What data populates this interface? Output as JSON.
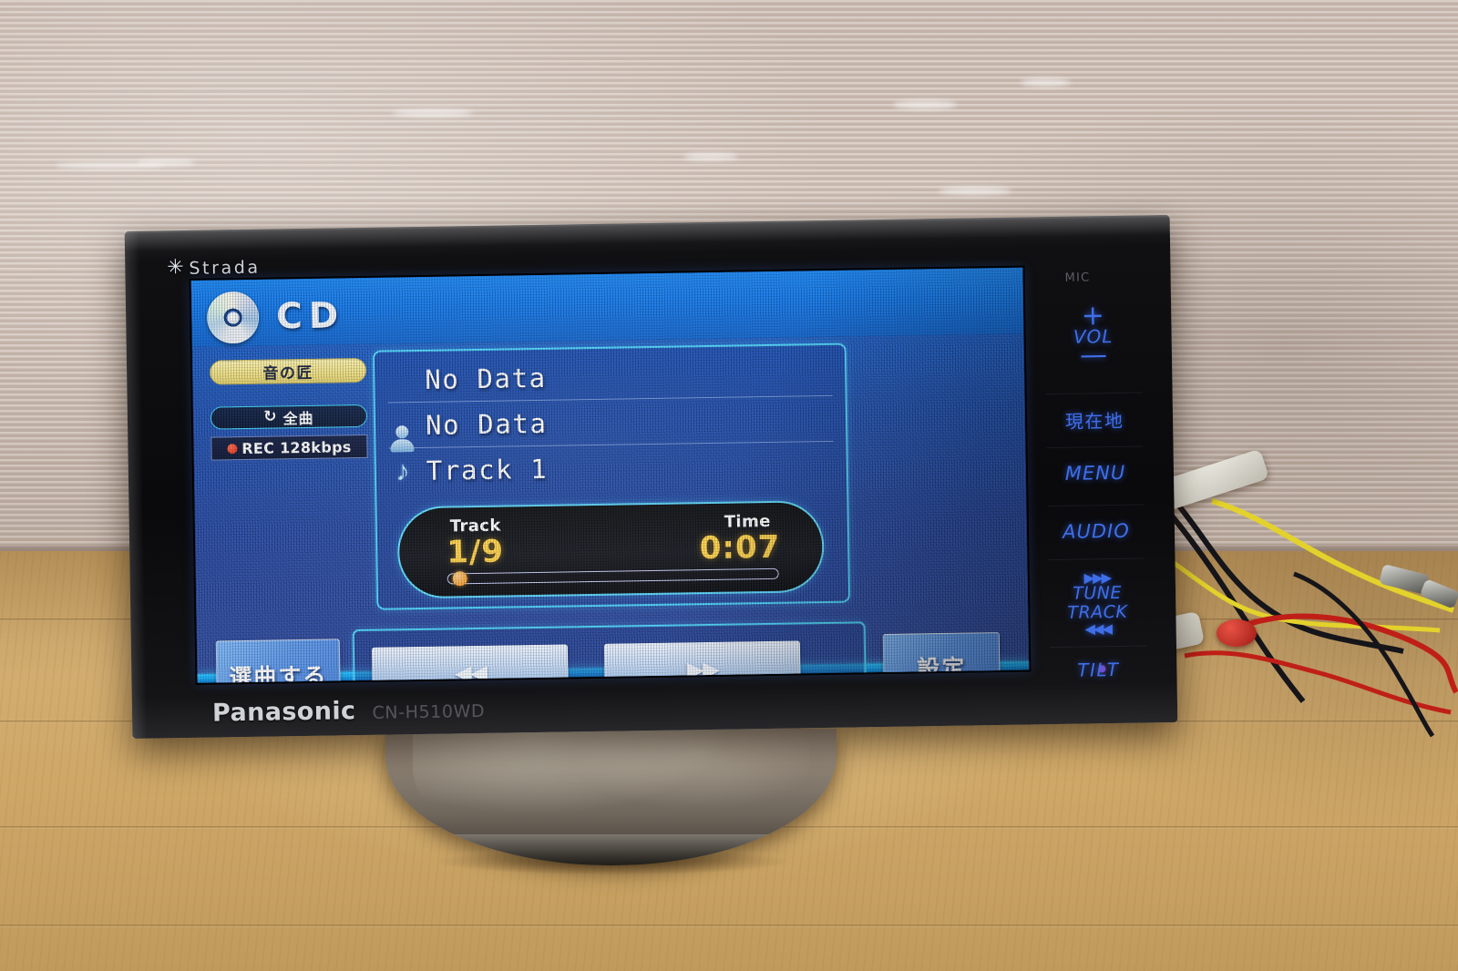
{
  "scene": {
    "description": "Panasonic Strada CN-H510WD car navigation head unit standing on a metal stand on a wooden floor against a striped wall"
  },
  "device": {
    "brand": "Panasonic",
    "model": "CN-H510WD",
    "series_logo": "Strada",
    "series_star_glyph": "✳",
    "mic_label": "MIC"
  },
  "screen": {
    "header": {
      "source_icon": "cd-disc-icon",
      "source_label": "CD"
    },
    "left_badges": {
      "sound_mode": "音の匠",
      "repeat_icon": "↻",
      "repeat_label": "全曲",
      "rec_dot": "record-dot",
      "rec_label": "REC 128kbps"
    },
    "info_rows": [
      {
        "icon": "disc-icon",
        "text": "No Data"
      },
      {
        "icon": "person-icon",
        "text": "No Data"
      },
      {
        "icon": "music-note-icon",
        "text": "Track 1"
      }
    ],
    "playback": {
      "track_label": "Track",
      "track_value": "1/9",
      "time_label": "Time",
      "time_value": "0:07",
      "progress_percent": 3
    },
    "buttons": {
      "select_track": "選曲する",
      "prev_icon": "◀◀",
      "next_icon": "▶▶",
      "settings": "設定"
    }
  },
  "hard_buttons": {
    "vol_plus": "+",
    "vol_label": "VOL",
    "vol_minus": "—",
    "current_location": "現在地",
    "menu": "MENU",
    "audio": "AUDIO",
    "tune_up_icon": "▶▶▶",
    "tune_line1": "TUNE",
    "tune_line2": "TRACK",
    "tune_down_icon": "◀◀◀",
    "tilt": "TILT"
  },
  "colors": {
    "screen_blue": "#1d4fae",
    "header_blue": "#1478e8",
    "accent_cyan": "#4fd9ff",
    "value_yellow": "#ffd24a",
    "badge_yellow": "#eee08a",
    "button_blue": "#5d97e8",
    "hard_button_blue": "#3f6fe8",
    "rec_red": "#d62a12"
  }
}
